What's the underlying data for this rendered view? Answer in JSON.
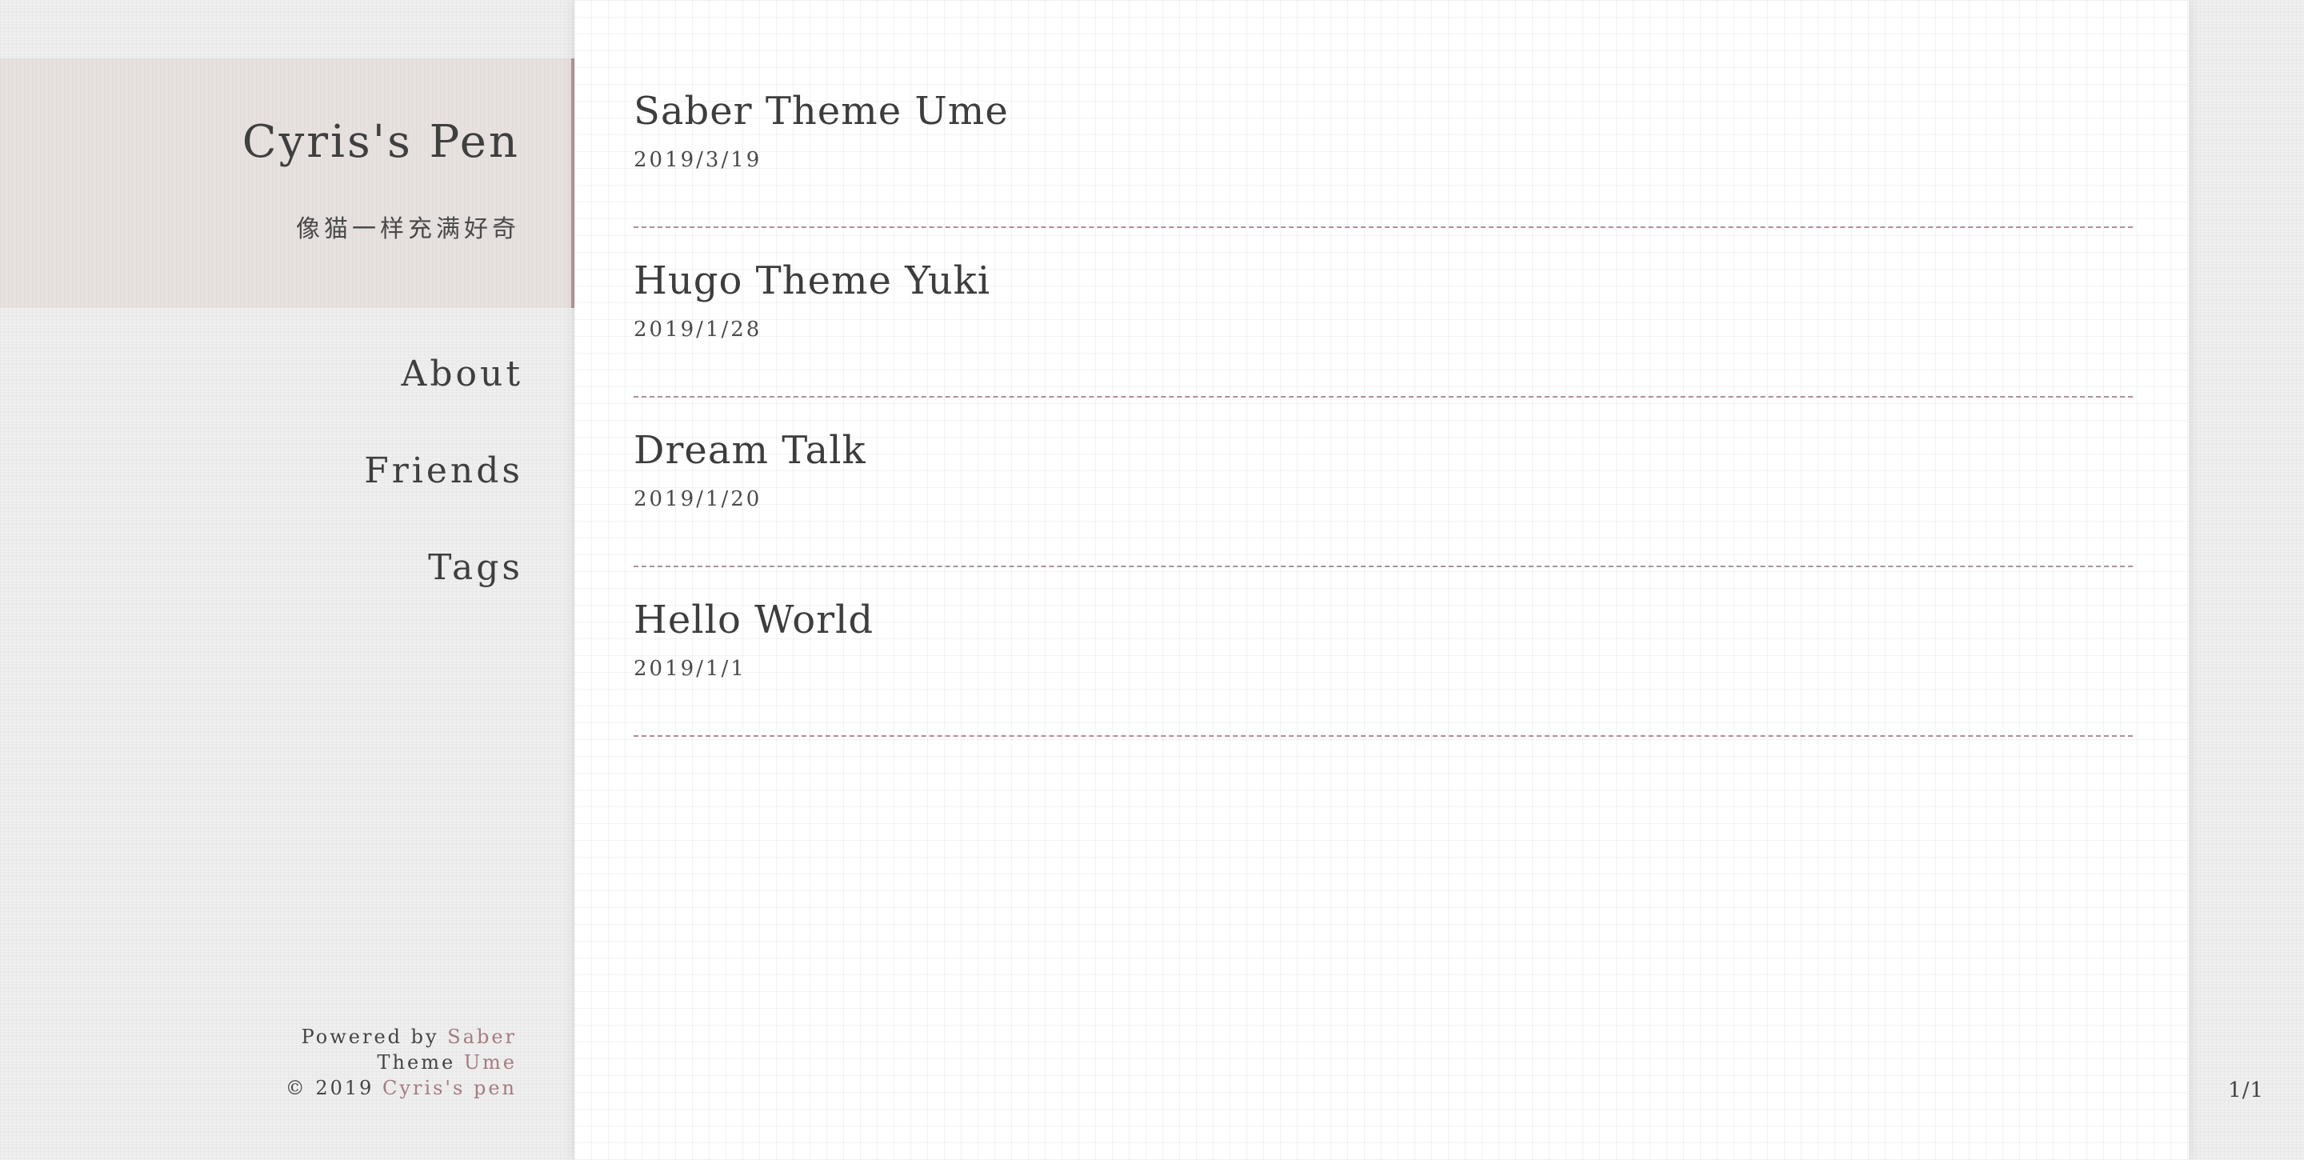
{
  "site": {
    "title": "Cyris's Pen",
    "subtitle": "像猫一样充满好奇"
  },
  "nav": {
    "items": [
      {
        "label": "About"
      },
      {
        "label": "Friends"
      },
      {
        "label": "Tags"
      }
    ]
  },
  "posts": [
    {
      "title": "Saber Theme Ume",
      "date": "2019/3/19"
    },
    {
      "title": "Hugo Theme Yuki",
      "date": "2019/1/28"
    },
    {
      "title": "Dream Talk",
      "date": "2019/1/20"
    },
    {
      "title": "Hello World",
      "date": "2019/1/1"
    }
  ],
  "footer": {
    "powered_prefix": "Powered by ",
    "powered_link": "Saber",
    "theme_prefix": "Theme ",
    "theme_link": "Ume",
    "copyright_prefix": "© 2019 ",
    "copyright_link": "Cyris's pen"
  },
  "pagination": {
    "text": "1/1"
  },
  "colors": {
    "accent": "#b2979a",
    "link": "#a47b81",
    "text": "#3d3d3d",
    "divider": "#b58c94"
  }
}
